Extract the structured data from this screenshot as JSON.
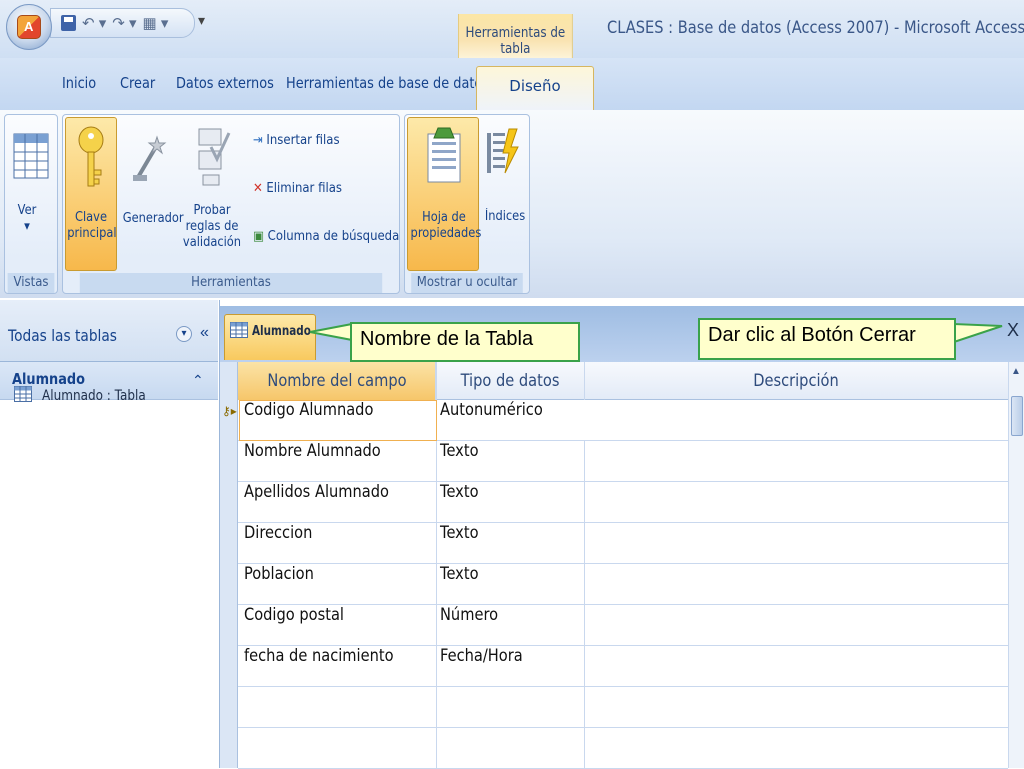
{
  "window": {
    "context_tab_header": "Herramientas de tabla",
    "title": "CLASES : Base de datos (Access 2007) - Microsoft Access"
  },
  "tabs": [
    "Inicio",
    "Crear",
    "Datos externos",
    "Herramientas de base de datos",
    "Diseño"
  ],
  "ribbon": {
    "vistas": {
      "ver_label": "Ver",
      "group_label": "Vistas"
    },
    "herramientas": {
      "clave_principal_label": "Clave principal",
      "generador_label": "Generador",
      "probar_reglas_label": "Probar reglas de validación",
      "insertar_filas_label": "Insertar filas",
      "eliminar_filas_label": "Eliminar filas",
      "columna_busqueda_label": "Columna de búsqueda",
      "group_label": "Herramientas"
    },
    "mostrar": {
      "hoja_propiedades_label": "Hoja de propiedades",
      "indices_label": "Índices",
      "group_label": "Mostrar u ocultar"
    }
  },
  "nav": {
    "title": "Todas las tablas",
    "group_label": "Alumnado",
    "item_label": "Alumnado : Tabla"
  },
  "document": {
    "tab_label": "Alumnado",
    "close_label": "X"
  },
  "annotations": {
    "callout_1": "Nombre de la Tabla",
    "callout_2": "Dar clic al Botón Cerrar"
  },
  "grid": {
    "headers": {
      "field": "Nombre del campo",
      "type": "Tipo de datos",
      "description": "Descripción"
    },
    "rows": [
      {
        "field": "Codigo Alumnado",
        "type": "Autonumérico"
      },
      {
        "field": "Nombre Alumnado",
        "type": "Texto"
      },
      {
        "field": "Apellidos Alumnado",
        "type": "Texto"
      },
      {
        "field": "Direccion",
        "type": "Texto"
      },
      {
        "field": "Poblacion",
        "type": "Texto"
      },
      {
        "field": "Codigo postal",
        "type": "Número"
      },
      {
        "field": "fecha de nacimiento",
        "type": "Fecha/Hora"
      }
    ]
  },
  "colors": {
    "accent": "#f8c95e",
    "ribbon_blue": "#c3d7f1",
    "callout_border": "#3aa24a",
    "callout_fill": "#ffffcc"
  }
}
